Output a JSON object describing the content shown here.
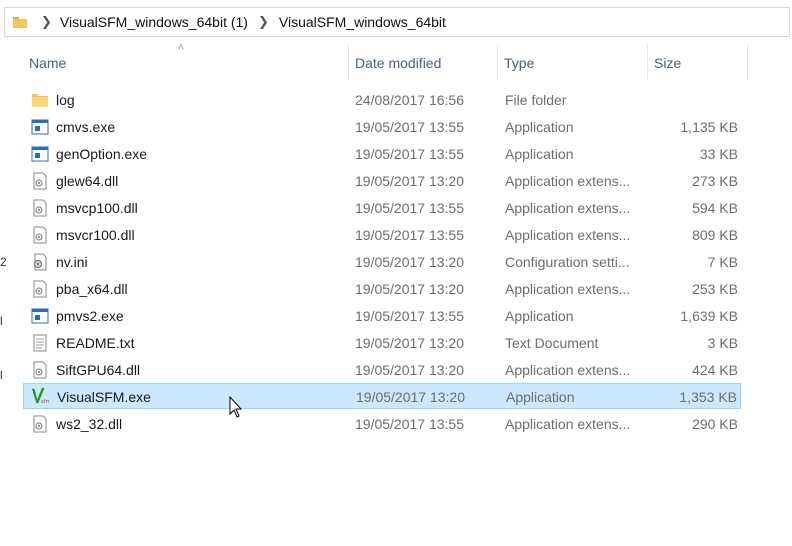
{
  "address_bar": {
    "crumbs": [
      "VisualSFM_windows_64bit (1)",
      "VisualSFM_windows_64bit"
    ]
  },
  "left_edge_glyphs": [
    "2",
    "l",
    "l"
  ],
  "columns": {
    "name": "Name",
    "date": "Date modified",
    "type": "Type",
    "size": "Size"
  },
  "files": [
    {
      "name": "log",
      "date": "24/08/2017 16:56",
      "type": "File folder",
      "size": "",
      "icon": "folder-icon"
    },
    {
      "name": "cmvs.exe",
      "date": "19/05/2017 13:55",
      "type": "Application",
      "size": "1,135 KB",
      "icon": "application-icon"
    },
    {
      "name": "genOption.exe",
      "date": "19/05/2017 13:55",
      "type": "Application",
      "size": "33 KB",
      "icon": "application-icon"
    },
    {
      "name": "glew64.dll",
      "date": "19/05/2017 13:20",
      "type": "Application extens...",
      "size": "273 KB",
      "icon": "dll-file-icon"
    },
    {
      "name": "msvcp100.dll",
      "date": "19/05/2017 13:55",
      "type": "Application extens...",
      "size": "594 KB",
      "icon": "dll-file-icon"
    },
    {
      "name": "msvcr100.dll",
      "date": "19/05/2017 13:55",
      "type": "Application extens...",
      "size": "809 KB",
      "icon": "dll-file-icon"
    },
    {
      "name": "nv.ini",
      "date": "19/05/2017 13:20",
      "type": "Configuration setti...",
      "size": "7 KB",
      "icon": "config-file-icon"
    },
    {
      "name": "pba_x64.dll",
      "date": "19/05/2017 13:20",
      "type": "Application extens...",
      "size": "253 KB",
      "icon": "dll-file-icon"
    },
    {
      "name": "pmvs2.exe",
      "date": "19/05/2017 13:55",
      "type": "Application",
      "size": "1,639 KB",
      "icon": "application-icon"
    },
    {
      "name": "README.txt",
      "date": "19/05/2017 13:20",
      "type": "Text Document",
      "size": "3 KB",
      "icon": "text-file-icon"
    },
    {
      "name": "SiftGPU64.dll",
      "date": "19/05/2017 13:20",
      "type": "Application extens...",
      "size": "424 KB",
      "icon": "dll-file-icon"
    },
    {
      "name": "VisualSFM.exe",
      "date": "19/05/2017 13:20",
      "type": "Application",
      "size": "1,353 KB",
      "icon": "visualsfm-app-icon",
      "selected": true
    },
    {
      "name": "ws2_32.dll",
      "date": "19/05/2017 13:55",
      "type": "Application extens...",
      "size": "290 KB",
      "icon": "dll-file-icon"
    }
  ],
  "colors": {
    "selection_fill": "#cce8ff",
    "selection_border": "#99d1ff",
    "header_text": "#4c607a",
    "folder": "#f2c55c"
  }
}
